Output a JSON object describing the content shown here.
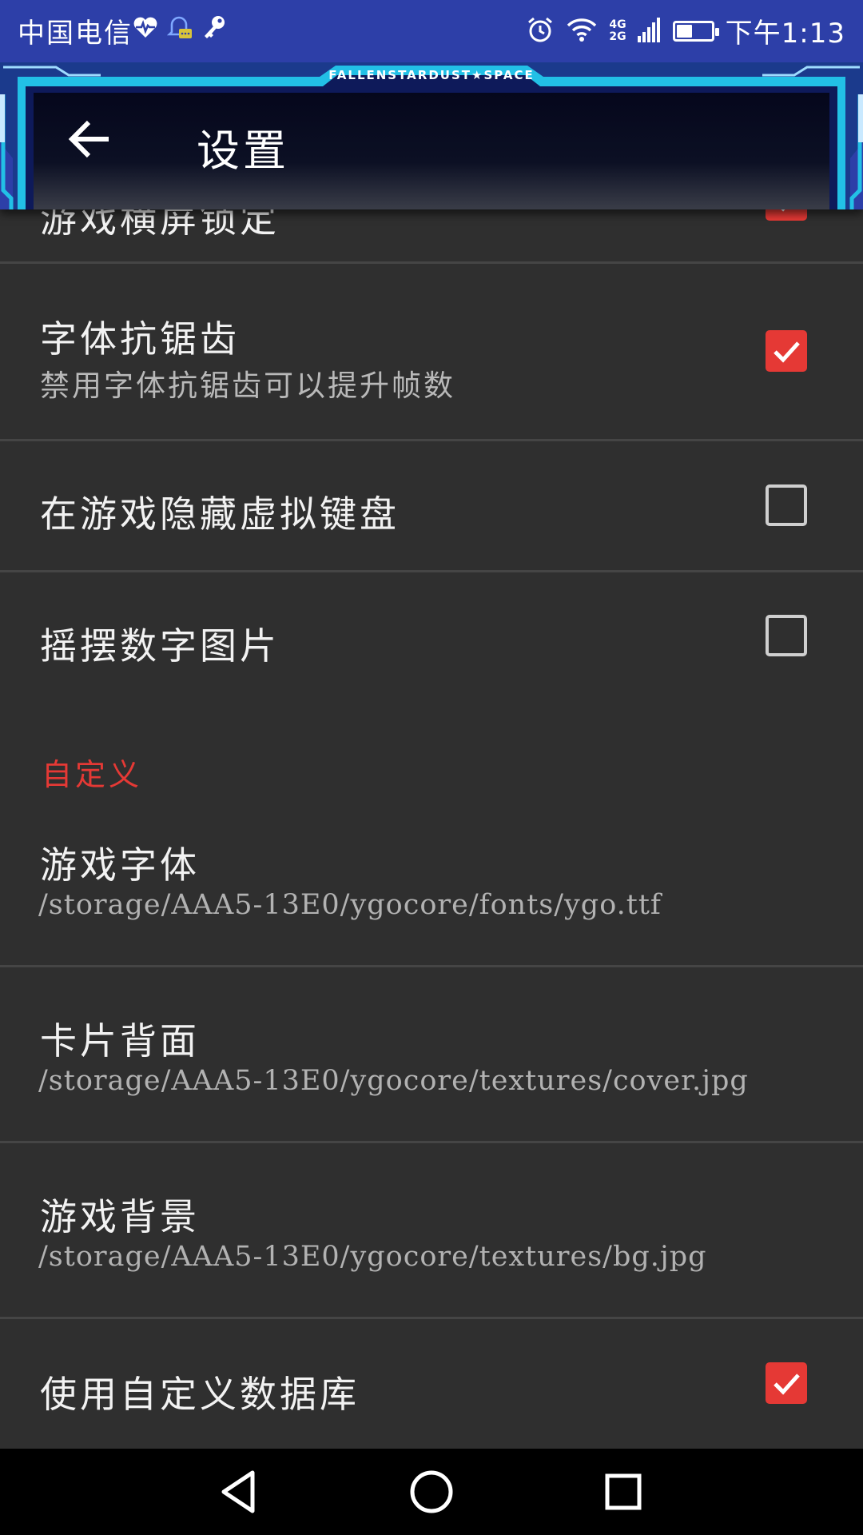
{
  "status_bar": {
    "carrier": "中国电信",
    "network_type_top": "4G",
    "network_type_bottom": "2G",
    "clock": "下午1:13",
    "battery_level": 0.45,
    "icons": [
      "heart-pulse-icon",
      "notification-bell-icon",
      "key-icon",
      "alarm-icon",
      "wifi-icon",
      "signal-icon",
      "battery-icon"
    ]
  },
  "header": {
    "brand": "FALLENSTARDUST★SPACE",
    "title": "设置",
    "back_icon": "arrow-left-icon"
  },
  "settings": {
    "partial_top_label": "游戏横屏锁定",
    "partial_top_checked": true,
    "font_antialias": {
      "label": "字体抗锯齿",
      "summary": "禁用字体抗锯齿可以提升帧数",
      "checked": true
    },
    "hide_keyboard": {
      "label": "在游戏隐藏虚拟键盘",
      "checked": false
    },
    "wobble_numbers": {
      "label": "摇摆数字图片",
      "checked": false
    },
    "custom_section": {
      "title": "自定义"
    },
    "game_font": {
      "label": "游戏字体",
      "path": "/storage/AAA5-13E0/ygocore/fonts/ygo.ttf"
    },
    "card_back": {
      "label": "卡片背面",
      "path": "/storage/AAA5-13E0/ygocore/textures/cover.jpg"
    },
    "game_background": {
      "label": "游戏背景",
      "path": "/storage/AAA5-13E0/ygocore/textures/bg.jpg"
    },
    "custom_database": {
      "label": "使用自定义数据库",
      "checked": true
    }
  },
  "nav_bar": {
    "buttons": [
      "back-triangle-icon",
      "home-circle-icon",
      "recents-square-icon"
    ]
  },
  "colors": {
    "status_bar": "#2d3fa8",
    "accent": "#e53935",
    "background": "#2f2f2f",
    "divider": "#454545"
  }
}
